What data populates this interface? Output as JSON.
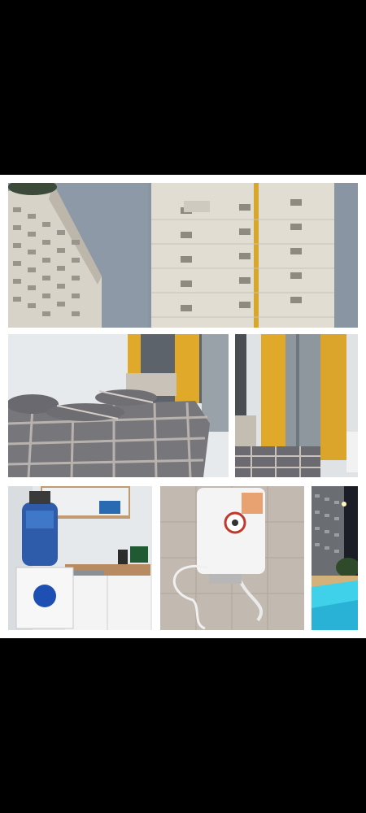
{
  "collage": {
    "photos": [
      {
        "id": "tower-left",
        "subject": "apartment-tower"
      },
      {
        "id": "tower-right",
        "subject": "apartment-tower"
      },
      {
        "id": "bedroom-wide",
        "subject": "bedroom"
      },
      {
        "id": "bedroom-window",
        "subject": "bedroom"
      },
      {
        "id": "kitchenette",
        "subject": "water-dispenser-and-sink"
      },
      {
        "id": "water-heater",
        "subject": "water-heater"
      },
      {
        "id": "pool-night",
        "subject": "swimming-pool"
      }
    ]
  },
  "colors": {
    "sky": "#8a95a3",
    "facade": "#e3dfd6",
    "curtain": "#e0a92a",
    "blanket_dark": "#5b5a5e",
    "blanket_light": "#c9c2bc",
    "wall": "#e9ecef",
    "pool": "#3fd0ea",
    "night": "#1b1e26"
  }
}
